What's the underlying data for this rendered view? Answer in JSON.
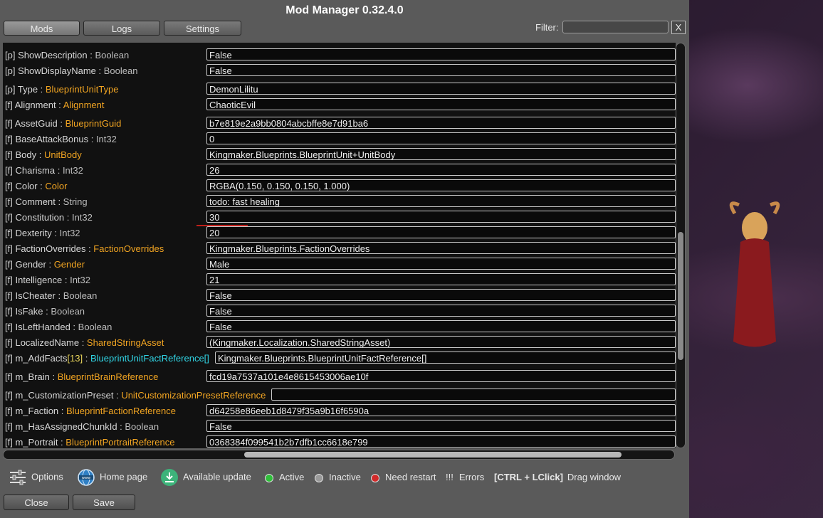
{
  "window": {
    "title": "Mod Manager 0.32.4.0"
  },
  "tabs": {
    "mods": "Mods",
    "logs": "Logs",
    "settings": "Settings"
  },
  "filter": {
    "label": "Filter:",
    "value": "",
    "clear_label": "X"
  },
  "rows": [
    {
      "kind": "[p]",
      "name": "ShowDescription",
      "type": "Boolean",
      "primitive": true,
      "value": "False"
    },
    {
      "kind": "[p]",
      "name": "ShowDisplayName",
      "type": "Boolean",
      "primitive": true,
      "value": "False"
    },
    {
      "kind": "[p]",
      "name": "Type",
      "type": "BlueprintUnitType",
      "primitive": false,
      "value": "DemonLilitu"
    },
    {
      "kind": "[f]",
      "name": "Alignment",
      "type": "Alignment",
      "primitive": false,
      "value": "ChaoticEvil"
    },
    {
      "kind": "[f]",
      "name": "AssetGuid",
      "type": "BlueprintGuid",
      "primitive": false,
      "value": "b7e819e2a9bb0804abcbffe8e7d91ba6"
    },
    {
      "kind": "[f]",
      "name": "BaseAttackBonus",
      "type": "Int32",
      "primitive": true,
      "value": "0"
    },
    {
      "kind": "[f]",
      "name": "Body",
      "type": "UnitBody",
      "primitive": false,
      "value": "Kingmaker.Blueprints.BlueprintUnit+UnitBody"
    },
    {
      "kind": "[f]",
      "name": "Charisma",
      "type": "Int32",
      "primitive": true,
      "value": "26"
    },
    {
      "kind": "[f]",
      "name": "Color",
      "type": "Color",
      "primitive": false,
      "value": "RGBA(0.150, 0.150, 0.150, 1.000)"
    },
    {
      "kind": "[f]",
      "name": "Comment",
      "type": "String",
      "primitive": true,
      "value": "todo: fast healing"
    },
    {
      "kind": "[f]",
      "name": "Constitution",
      "type": "Int32",
      "primitive": true,
      "value": "30"
    },
    {
      "kind": "[f]",
      "name": "Dexterity",
      "type": "Int32",
      "primitive": true,
      "value": "20"
    },
    {
      "kind": "[f]",
      "name": "FactionOverrides",
      "type": "FactionOverrides",
      "primitive": false,
      "value": "Kingmaker.Blueprints.FactionOverrides"
    },
    {
      "kind": "[f]",
      "name": "Gender",
      "type": "Gender",
      "primitive": false,
      "value": "Male"
    },
    {
      "kind": "[f]",
      "name": "Intelligence",
      "type": "Int32",
      "primitive": true,
      "value": "21"
    },
    {
      "kind": "[f]",
      "name": "IsCheater",
      "type": "Boolean",
      "primitive": true,
      "value": "False"
    },
    {
      "kind": "[f]",
      "name": "IsFake",
      "type": "Boolean",
      "primitive": true,
      "value": "False"
    },
    {
      "kind": "[f]",
      "name": "IsLeftHanded",
      "type": "Boolean",
      "primitive": true,
      "value": "False"
    },
    {
      "kind": "[f]",
      "name": "LocalizedName",
      "type": "SharedStringAsset",
      "primitive": false,
      "value": " (Kingmaker.Localization.SharedStringAsset)"
    },
    {
      "kind": "[f]",
      "name": "m_AddFacts",
      "count": "[13]",
      "type": "BlueprintUnitFactReference[]",
      "primitive": false,
      "array": true,
      "value": "Kingmaker.Blueprints.BlueprintUnitFactReference[]"
    },
    {
      "kind": "[f]",
      "name": "m_Brain",
      "type": "BlueprintBrainReference",
      "primitive": false,
      "value": "fcd19a7537a101e4e8615453006ae10f"
    },
    {
      "kind": "[f]",
      "name": "m_CustomizationPreset",
      "type": "UnitCustomizationPresetReference",
      "primitive": false,
      "value": ""
    },
    {
      "kind": "[f]",
      "name": "m_Faction",
      "type": "BlueprintFactionReference",
      "primitive": false,
      "value": "d64258e86eeb1d8479f35a9b16f6590a"
    },
    {
      "kind": "[f]",
      "name": "m_HasAssignedChunkId",
      "type": "Boolean",
      "primitive": true,
      "value": "False"
    },
    {
      "kind": "[f]",
      "name": "m_Portrait",
      "type": "BlueprintPortraitReference",
      "primitive": false,
      "value": "0368384f099541b2b7dfb1cc6618e799"
    }
  ],
  "footer": {
    "options": "Options",
    "home_page": "Home page",
    "available_update": "Available update",
    "active": "Active",
    "inactive": "Inactive",
    "need_restart": "Need restart",
    "errors_mark": "!!!",
    "errors": "Errors",
    "shortcut": "[CTRL + LClick]",
    "drag_window": "Drag window"
  },
  "buttons": {
    "close": "Close",
    "save": "Save"
  },
  "colors": {
    "type_orange": "#f2a522",
    "array_cyan": "#31d6e6",
    "count_yellow": "#e6d25a",
    "active_green": "#2fbf3a",
    "inactive_gray": "#9a9a9a",
    "restart_red": "#d22a2a"
  }
}
